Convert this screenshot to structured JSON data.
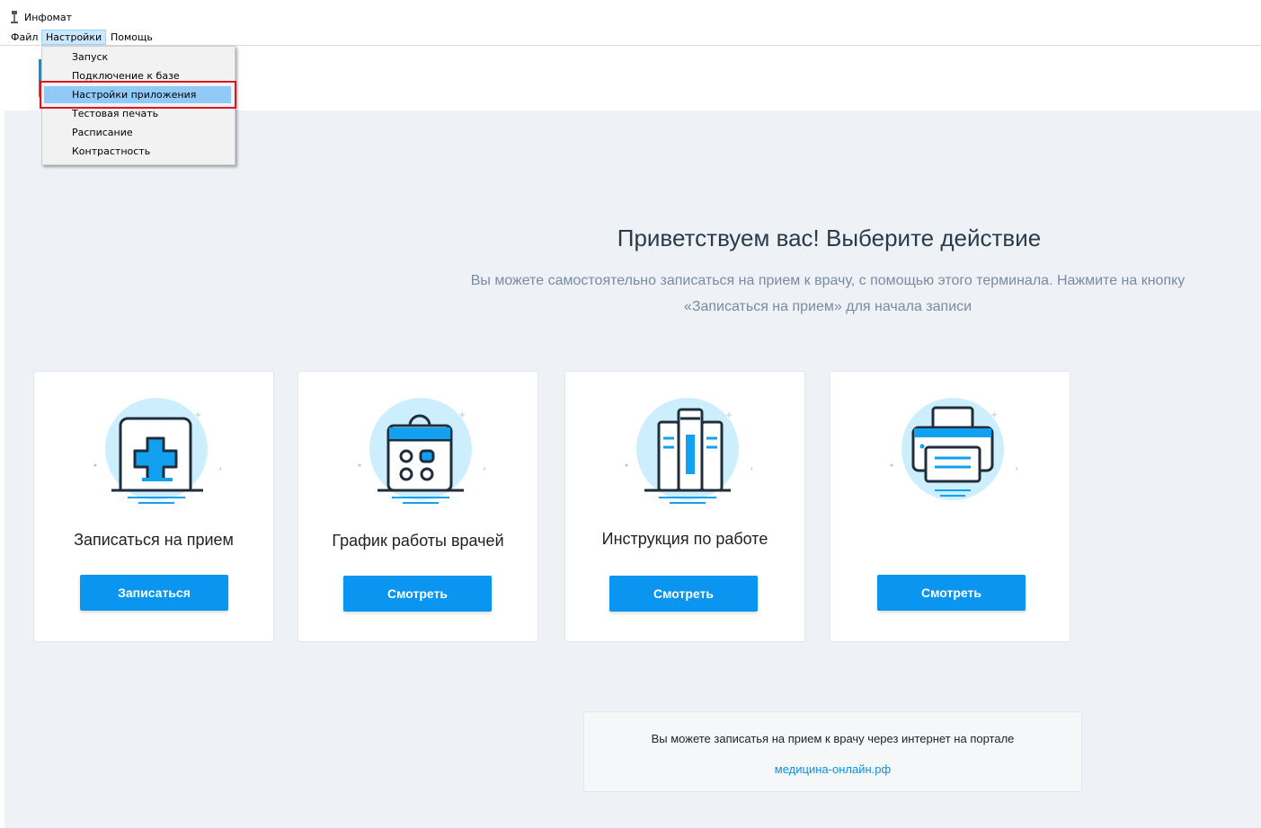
{
  "window": {
    "title": "Инфомат",
    "icon": "infomat-app-icon"
  },
  "menubar": {
    "items": [
      {
        "label": "Файл"
      },
      {
        "label": "Настройки"
      },
      {
        "label": "Помощь"
      }
    ]
  },
  "settings_menu": {
    "items": [
      {
        "label": "Запуск"
      },
      {
        "label": "Подключение к базе"
      },
      {
        "label": "Настройки приложения"
      },
      {
        "label": "Тестовая печать"
      },
      {
        "label": "Расписание"
      },
      {
        "label": "Контрастность"
      }
    ],
    "selected_index": 2
  },
  "welcome": {
    "title": "Приветствуем вас! Выберите действие",
    "subtitle": "Вы можете самостоятельно записаться на прием к врачу, с помощью этого терминала. Нажмите на кнопку «Записаться на прием» для начала записи"
  },
  "cards": [
    {
      "title": "Записаться на прием",
      "button": "Записаться",
      "icon": "medical-cross-icon"
    },
    {
      "title": "График работы врачей",
      "button": "Смотреть",
      "icon": "calendar-schedule-icon"
    },
    {
      "title": "Инструкция по работе",
      "button": "Смотреть",
      "icon": "books-instructions-icon"
    },
    {
      "title": "",
      "button": "Смотреть",
      "icon": "printer-icon"
    }
  ],
  "info": {
    "text": "Вы можете записатья на прием к врачу через интернет на портале",
    "link": "медицина-онлайн.рф"
  },
  "colors": {
    "accent": "#0a96f0",
    "icon_circle": "#cdeffd",
    "icon_stroke": "#1f2e3d",
    "background": "#eef2f6",
    "highlight": "#e0141e"
  }
}
